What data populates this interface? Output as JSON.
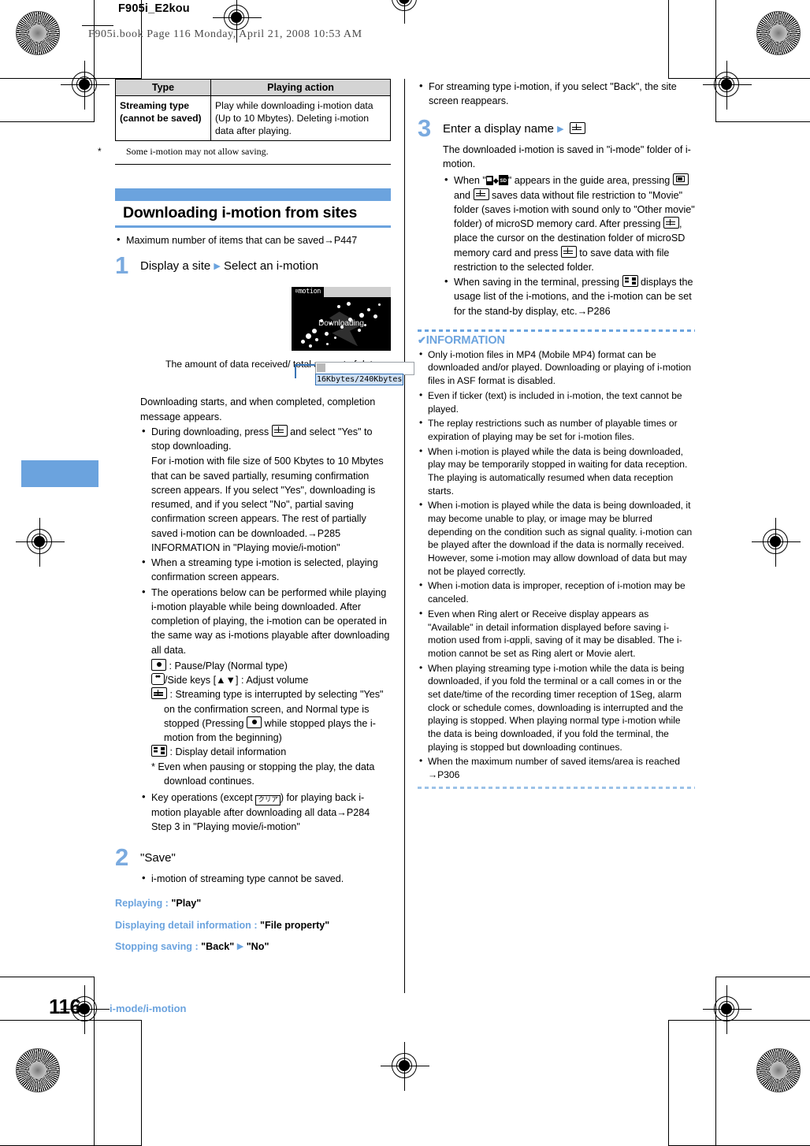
{
  "printmarks": {
    "doc_id": "F905i_E2kou",
    "book_line": "F905i.book  Page 116  Monday, April 21, 2008  10:53 AM"
  },
  "table": {
    "headers": [
      "Type",
      "Playing action"
    ],
    "rows": [
      {
        "type": "Streaming type (cannot be saved)",
        "action": "Play while downloading i-motion data (Up to 10 Mbytes). Deleting i-motion data after playing."
      }
    ],
    "footnote_marker": "*",
    "footnote": "Some i-motion may not allow saving."
  },
  "section": {
    "title": "Downloading i-motion from sites",
    "intro_bullets": [
      "Maximum number of items that can be saved→P447"
    ]
  },
  "steps": [
    {
      "num": "1",
      "head_a": "Display a site",
      "head_b": "Select an i-motion",
      "screenshot": {
        "status_label": "¤motion",
        "screen_text": "Downloading"
      },
      "callout": {
        "label": "The amount of data received/ total amount of data",
        "amount": "16Kbytes/240Kbytes"
      },
      "body": "Downloading starts, and when completed, completion message appears.",
      "bullets": [
        "During downloading, press [BOOK] and select \"Yes\" to stop downloading.",
        "For i-motion with file size of 500 Kbytes to 10 Mbytes that can be saved partially, resuming confirmation screen appears. If you select \"Yes\", downloading is resumed, and if you select \"No\", partial saving confirmation screen appears. The rest of partially saved i-motion can be downloaded.→P285 INFORMATION in \"Playing movie/i-motion\"",
        "When a streaming type i-motion is selected, playing confirmation screen appears.",
        "The operations below can be performed while playing i-motion playable while being downloaded. After completion of playing, the i-motion can be operated in the same way as i-motions playable after downloading all data."
      ],
      "key_ops": [
        ": Pause/Play (Normal type)",
        "/Side keys [▲▼] : Adjust volume",
        ": Streaming type is interrupted by selecting \"Yes\" on the confirmation screen, and Normal type is stopped (Pressing",
        "while stopped plays the i-motion from the beginning)",
        ": Display detail information"
      ],
      "key_note_marker": "*",
      "key_note": "Even when pausing or stopping the play, the data download continues.",
      "last_bullet_a": "Key operations (except",
      "clear_key": "クリア",
      "last_bullet_b": ") for playing back i-motion playable after downloading all data→P284 Step 3 in \"Playing movie/i-motion\""
    },
    {
      "num": "2",
      "head_a": "\"Save\"",
      "bullets": [
        "i-motion of streaming type cannot be saved."
      ]
    },
    {
      "num": "3",
      "head_a": "Enter a display name",
      "body": "The downloaded i-motion is saved in \"i-mode\" folder of i-motion.",
      "bullets_rich": [
        "When \" [PHONE] ◇ [SD] \" appears in the guide area, pressing [PIC] and [BOOK] saves data without file restriction to \"Movie\" folder (saves i-motion with sound only to \"Other movie\" folder) of microSD memory card. After pressing [BOOK] , place the cursor on the destination folder of microSD memory card and press [BOOK] to save data with file restriction to the selected folder.",
        "When saving in the terminal, pressing [MAIL] displays the usage list of the i-motions, and the i-motion can be set for the stand-by display, etc.→P286"
      ]
    }
  ],
  "right_top_bullet": "For streaming type i-motion, if you select \"Back\", the site screen reappears.",
  "operations": [
    {
      "label": "Replaying :",
      "value": "\"Play\""
    },
    {
      "label": "Displaying detail information :",
      "value": "\"File property\""
    },
    {
      "label": "Stopping saving :",
      "value_a": "\"Back\"",
      "value_b": "\"No\""
    }
  ],
  "information": {
    "title": "INFORMATION",
    "check": "✔",
    "items": [
      "Only i-motion files in MP4 (Mobile MP4) format can be downloaded and/or played. Downloading or playing of i-motion files in ASF format is disabled.",
      "Even if ticker (text) is included in i-motion, the text cannot be played.",
      "The replay restrictions such as number of playable times or expiration of playing may be set for i-motion files.",
      "When i-motion is played while the data is being downloaded, play may be temporarily stopped in waiting for data reception. The playing is automatically resumed when data reception starts.",
      "When i-motion is played while the data is being downloaded, it may become unable to play, or image may be blurred depending on the condition such as signal quality. i-motion can be played after the download if the data is normally received. However, some i-motion may allow download of data but may not be played correctly.",
      "When i-motion data is improper, reception of i-motion may be canceled.",
      "Even when Ring alert or Receive display appears as \"Available\" in detail information displayed before saving i-motion used from i-αppli, saving of it may be disabled. The i-motion cannot be set as Ring alert or Movie alert.",
      "When playing streaming type i-motion while the data is being downloaded, if you fold the terminal or a call comes in or the set date/time of the recording timer reception of 1Seg, alarm clock or schedule comes, downloading is interrupted and the playing is stopped. When playing normal type i-motion while the data is being downloaded, if you fold the terminal, the playing is stopped but downloading continues.",
      "When the maximum number of saved items/area is reached →P306"
    ]
  },
  "footer": {
    "page_number": "116",
    "running_head": "i-mode/i-motion"
  },
  "colors": {
    "accent_blue": "#6ba3de",
    "step_number_blue": "#7aaadf",
    "table_header_gray": "#d4d4d4"
  }
}
